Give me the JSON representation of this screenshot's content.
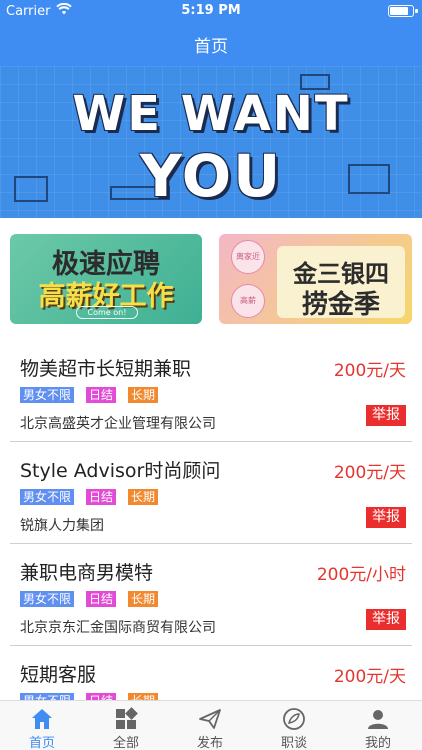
{
  "status_bar": {
    "carrier": "Carrier",
    "time": "5:19 PM",
    "battery_level": 0.9
  },
  "nav": {
    "title": "首页"
  },
  "banner": {
    "line1": "WE WANT",
    "line2": "YOU"
  },
  "promos": [
    {
      "line1": "极速应聘",
      "line2": "高薪好工作",
      "cta": "Come on!"
    },
    {
      "line1": "金三银四",
      "line2": "捞金季",
      "tag1": "离家近",
      "tag2": "高薪"
    }
  ],
  "jobs": [
    {
      "title": "物美超市长短期兼职",
      "salary": "200元/天",
      "tags": [
        "男女不限",
        "日结",
        "长期"
      ],
      "company": "北京高盛英才企业管理有限公司",
      "report": "举报"
    },
    {
      "title": "Style Advisor时尚顾问",
      "salary": "200元/天",
      "tags": [
        "男女不限",
        "日结",
        "长期"
      ],
      "company": "锐旗人力集团",
      "report": "举报"
    },
    {
      "title": "兼职电商男模特",
      "salary": "200元/小时",
      "tags": [
        "男女不限",
        "日结",
        "长期"
      ],
      "company": "北京京东汇金国际商贸有限公司",
      "report": "举报"
    },
    {
      "title": "短期客服",
      "salary": "200元/天",
      "tags": [
        "男女不限",
        "日结",
        "长期"
      ],
      "company": "",
      "report": ""
    }
  ],
  "tabbar": {
    "items": [
      {
        "label": "首页",
        "icon": "home-icon"
      },
      {
        "label": "全部",
        "icon": "grid-icon"
      },
      {
        "label": "发布",
        "icon": "send-icon"
      },
      {
        "label": "职谈",
        "icon": "chat-leaf-icon"
      },
      {
        "label": "我的",
        "icon": "person-icon"
      }
    ],
    "active_color": "#3f8cf2"
  },
  "colors": {
    "brand": "#3f8cf2",
    "salary": "#e4362f",
    "report": "#ea2e2e"
  }
}
